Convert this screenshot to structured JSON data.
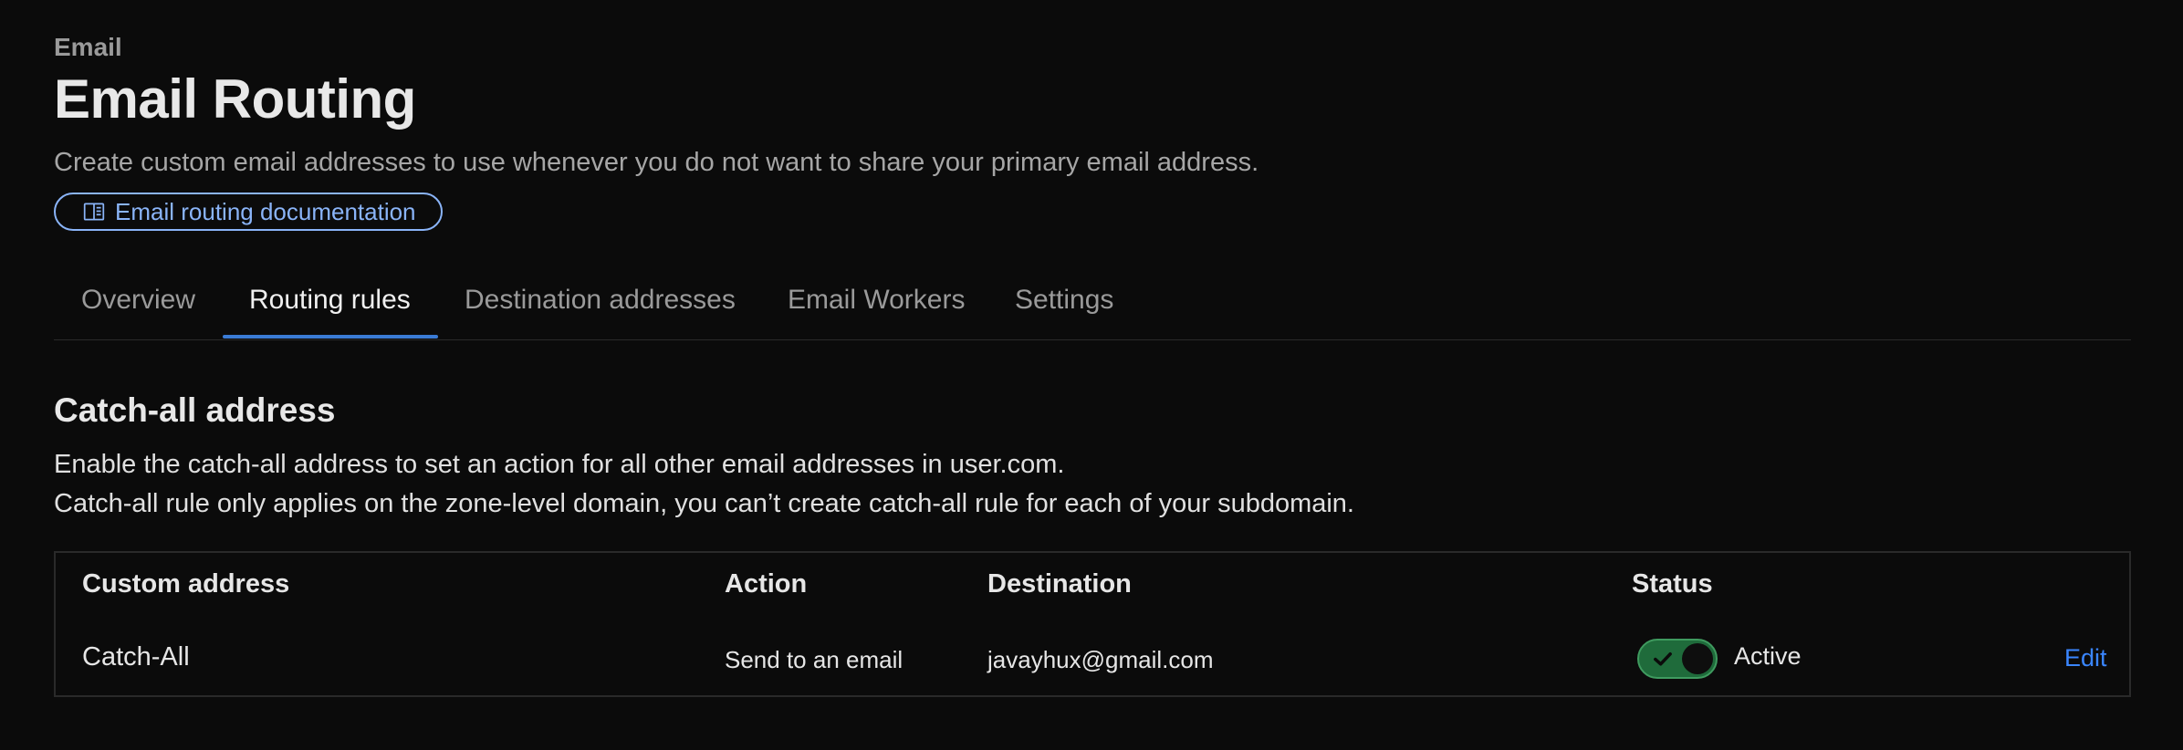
{
  "header": {
    "eyebrow": "Email",
    "title": "Email Routing",
    "description": "Create custom email addresses to use whenever you do not want to share your primary email address.",
    "doc_link_label": "Email routing documentation",
    "doc_link_icon": "book-icon"
  },
  "tabs": [
    {
      "label": "Overview",
      "active": false
    },
    {
      "label": "Routing rules",
      "active": true
    },
    {
      "label": "Destination addresses",
      "active": false
    },
    {
      "label": "Email Workers",
      "active": false
    },
    {
      "label": "Settings",
      "active": false
    }
  ],
  "catch_all": {
    "title": "Catch-all address",
    "line1": "Enable the catch-all address to set an action for all other email addresses in user.com.",
    "line2": "Catch-all rule only applies on the zone-level domain, you can’t create catch-all rule for each of your subdomain."
  },
  "table": {
    "headers": {
      "custom_address": "Custom address",
      "action": "Action",
      "destination": "Destination",
      "status": "Status"
    },
    "rows": [
      {
        "custom_address": "Catch-All",
        "action": "Send to an email",
        "destination": "javayhux@gmail.com",
        "status": "Active",
        "enabled": true,
        "edit_label": "Edit"
      }
    ]
  },
  "colors": {
    "background": "#0b0b0b",
    "link": "#8ab4f8",
    "accent": "#3a7bd5",
    "toggle_on": "#1f6b3b"
  }
}
